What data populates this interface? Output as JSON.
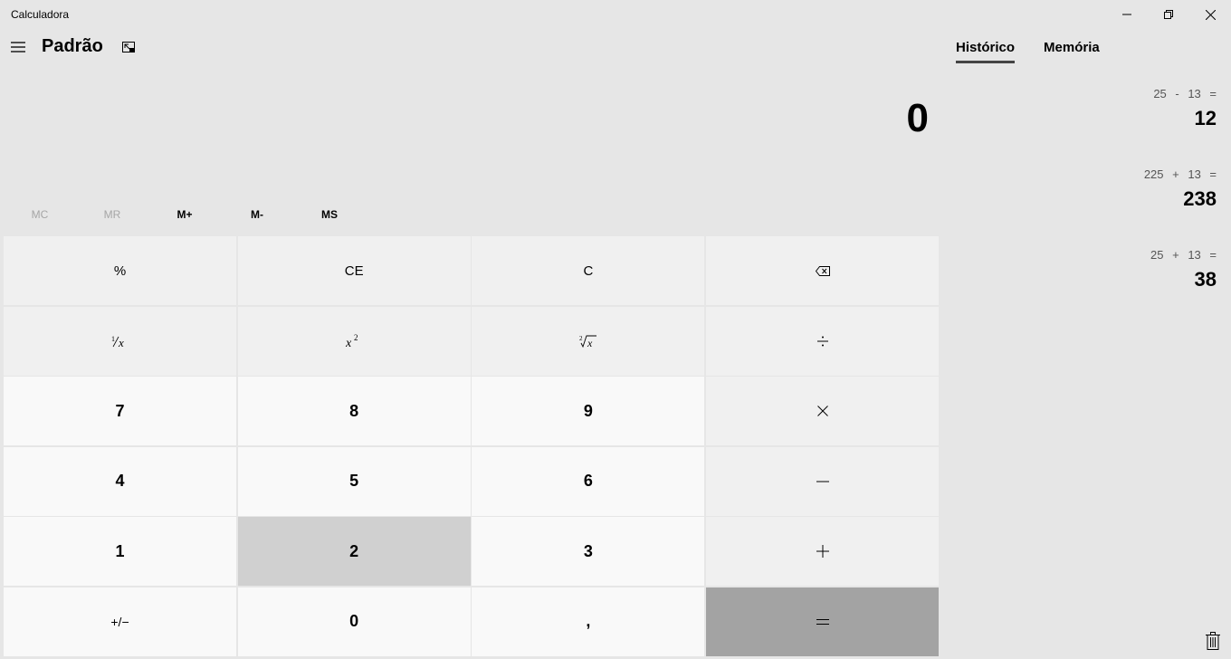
{
  "window": {
    "title": "Calculadora"
  },
  "header": {
    "mode": "Padrão"
  },
  "display": {
    "value": "0"
  },
  "memory": {
    "mc": "MC",
    "mr": "MR",
    "mplus": "M+",
    "mminus": "M-",
    "ms": "MS"
  },
  "keys": {
    "percent": "%",
    "ce": "CE",
    "c": "C",
    "seven": "7",
    "eight": "8",
    "nine": "9",
    "four": "4",
    "five": "5",
    "six": "6",
    "one": "1",
    "two": "2",
    "three": "3",
    "negate": "+/−",
    "zero": "0",
    "decimal": ","
  },
  "icons": {
    "hamburger": "menu-icon",
    "keep_on_top": "keep-on-top-icon",
    "backspace": "backspace-icon",
    "reciprocal": "reciprocal-icon",
    "square": "square-icon",
    "sqrt": "square-root-icon",
    "divide": "divide-icon",
    "multiply": "multiply-icon",
    "minus": "minus-icon",
    "plus": "plus-icon",
    "equals": "equals-icon",
    "trash": "trash-icon"
  },
  "panel": {
    "tabs": [
      {
        "label": "Histórico",
        "active": true
      },
      {
        "label": "Memória",
        "active": false
      }
    ],
    "history": [
      {
        "expression": "25 - 13 =",
        "result": "12"
      },
      {
        "expression": "225 + 13 =",
        "result": "238"
      },
      {
        "expression": "25 + 13 =",
        "result": "38"
      }
    ]
  },
  "colors": {
    "background": "#e6e6e6",
    "function_key": "#f0f0f0",
    "number_key": "#f9f9f9",
    "hovered_key": "#d0d0d0",
    "equals_key": "#a3a3a3"
  }
}
